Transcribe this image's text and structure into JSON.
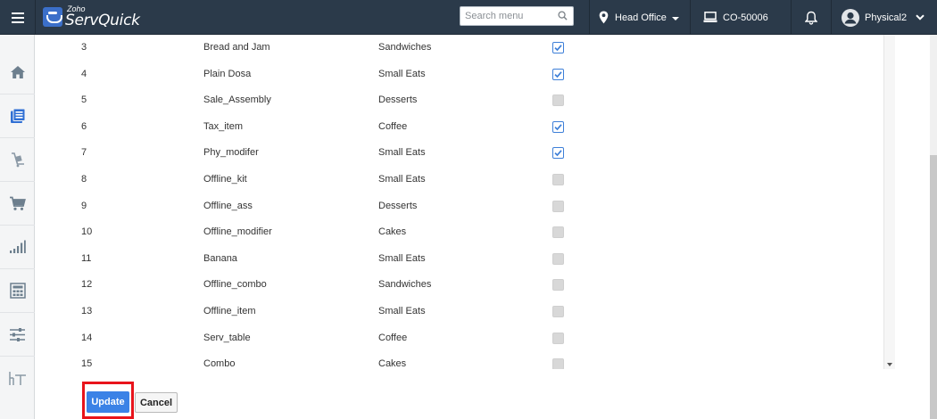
{
  "app": {
    "brand_small": "Zoho",
    "brand_name": "ServQuick",
    "accent_color": "#3b82e6",
    "topbar_color": "#2b3a4a"
  },
  "header": {
    "search_placeholder": "Search menu",
    "location": "Head Office",
    "register": "CO-50006",
    "user": "Physical2"
  },
  "sidebar": {
    "items": [
      {
        "icon": "home-icon"
      },
      {
        "icon": "catalog-icon"
      },
      {
        "icon": "inventory-icon"
      },
      {
        "icon": "cart-icon"
      },
      {
        "icon": "reports-icon"
      },
      {
        "icon": "calculator-icon"
      },
      {
        "icon": "settings-sliders-icon"
      },
      {
        "icon": "table-icon"
      }
    ]
  },
  "table": {
    "rows": [
      {
        "num": "3",
        "name": "Bread and Jam",
        "category": "Sandwiches",
        "checked": true
      },
      {
        "num": "4",
        "name": "Plain Dosa",
        "category": "Small Eats",
        "checked": true
      },
      {
        "num": "5",
        "name": "Sale_Assembly",
        "category": "Desserts",
        "checked": false
      },
      {
        "num": "6",
        "name": "Tax_item",
        "category": "Coffee",
        "checked": true
      },
      {
        "num": "7",
        "name": "Phy_modifer",
        "category": "Small Eats",
        "checked": true
      },
      {
        "num": "8",
        "name": "Offline_kit",
        "category": "Small Eats",
        "checked": false
      },
      {
        "num": "9",
        "name": "Offline_ass",
        "category": "Desserts",
        "checked": false
      },
      {
        "num": "10",
        "name": "Offline_modifier",
        "category": "Cakes",
        "checked": false
      },
      {
        "num": "11",
        "name": "Banana",
        "category": "Small Eats",
        "checked": false
      },
      {
        "num": "12",
        "name": "Offline_combo",
        "category": "Sandwiches",
        "checked": false
      },
      {
        "num": "13",
        "name": "Offline_item",
        "category": "Small Eats",
        "checked": false
      },
      {
        "num": "14",
        "name": "Serv_table",
        "category": "Coffee",
        "checked": false
      },
      {
        "num": "15",
        "name": "Combo",
        "category": "Cakes",
        "checked": false
      }
    ]
  },
  "actions": {
    "update_label": "Update",
    "cancel_label": "Cancel",
    "highlight_color": "#e8141b"
  }
}
